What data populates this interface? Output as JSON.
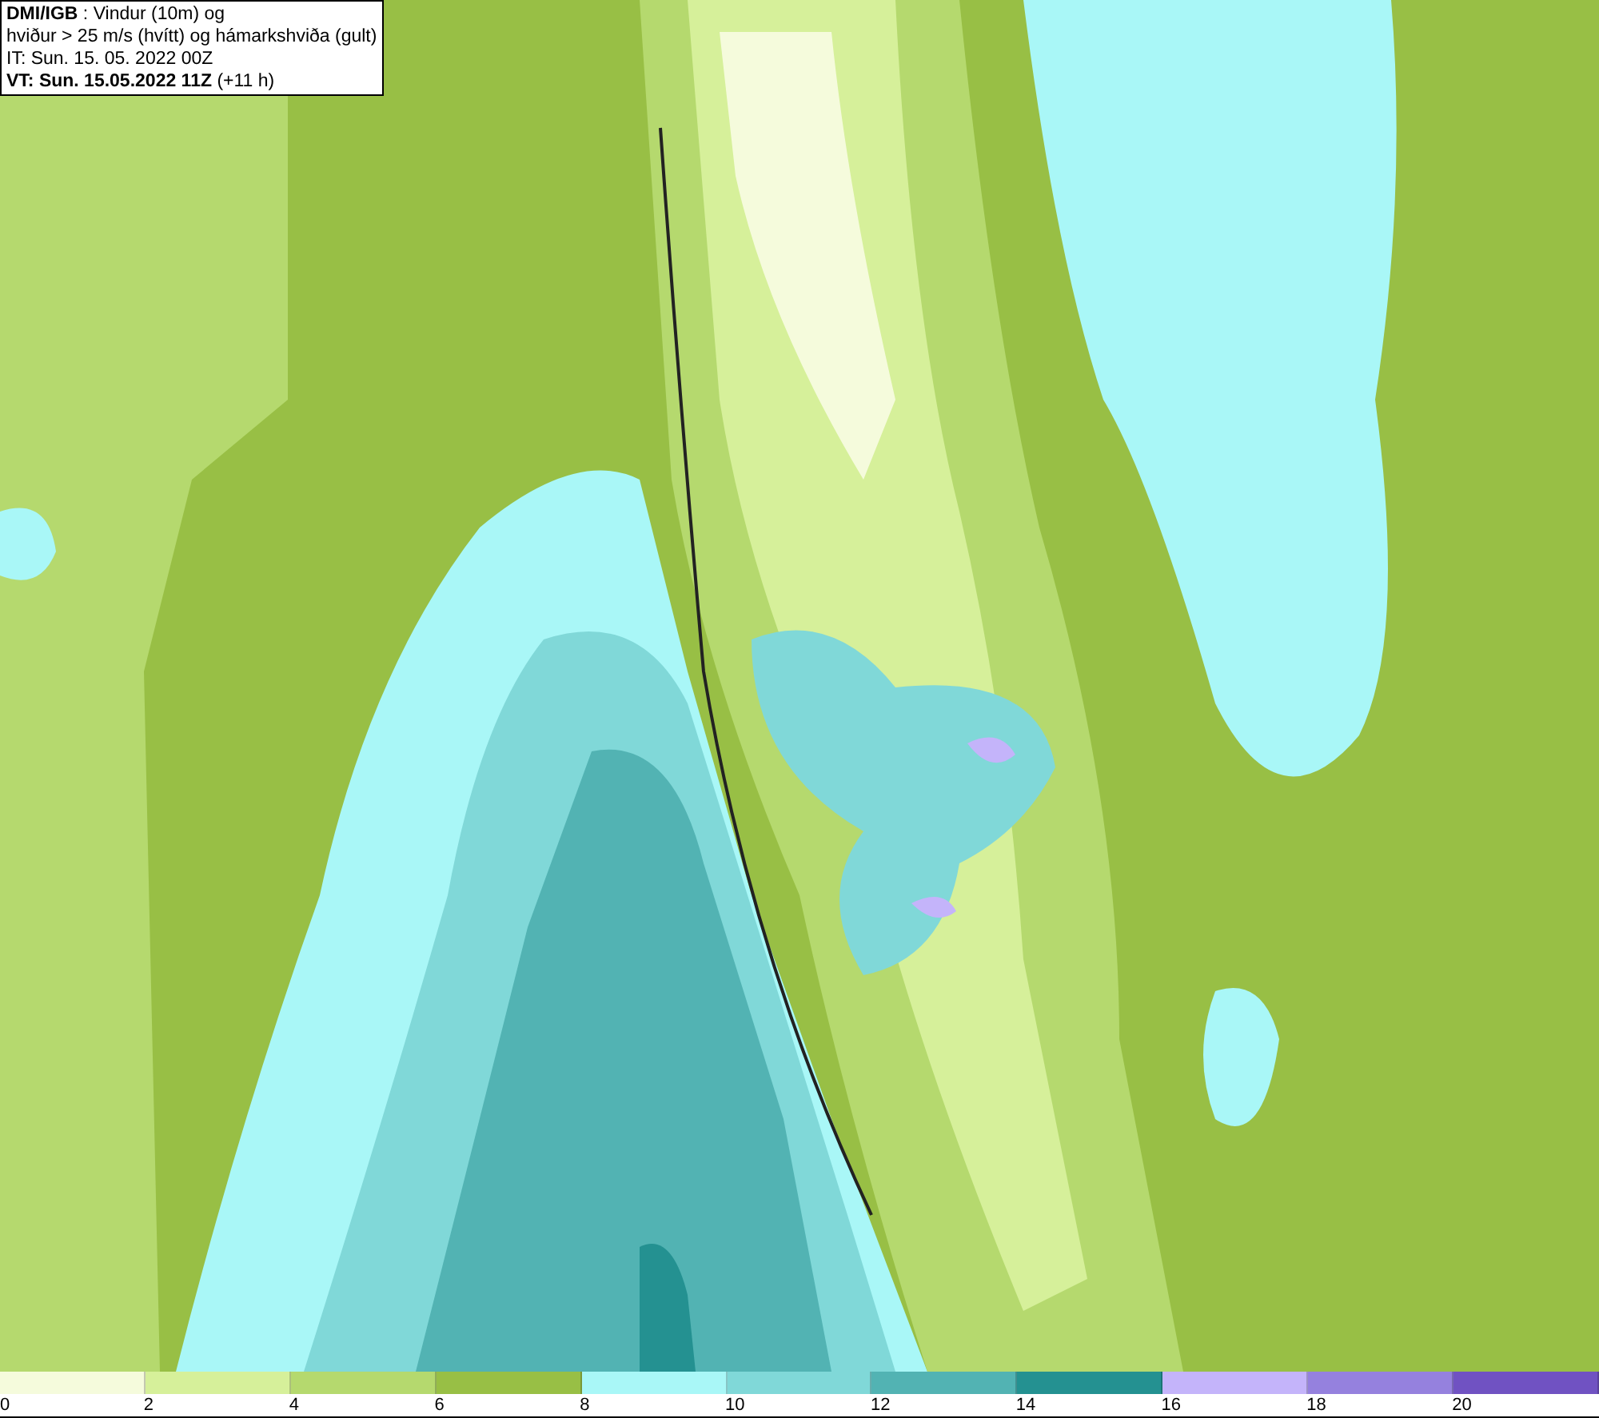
{
  "info_box": {
    "lines": [
      "**DMI/IGB** : Vindur (10m) og",
      "hviður > 25 m/s (hvítt) og hámarkshviða (gult)",
      "IT: Sun. 15. 05. 2022 00Z",
      "**VT: Sun. 15.05.2022 11Z** (+11 h)"
    ]
  },
  "colorbar": {
    "segments": [
      {
        "color": "#f5fbdc"
      },
      {
        "color": "#d6f09a"
      },
      {
        "color": "#b5d96e"
      },
      {
        "color": "#98bf45"
      },
      {
        "color": "#a9f7f7"
      },
      {
        "color": "#80d8d8"
      },
      {
        "color": "#52b3b3"
      },
      {
        "color": "#249191"
      },
      {
        "color": "#c4b4fa"
      },
      {
        "color": "#9581de"
      },
      {
        "color": "#7052c2"
      }
    ],
    "ticks": [
      "0",
      "2",
      "4",
      "6",
      "8",
      "10",
      "12",
      "14",
      "16",
      "18",
      "20"
    ]
  }
}
